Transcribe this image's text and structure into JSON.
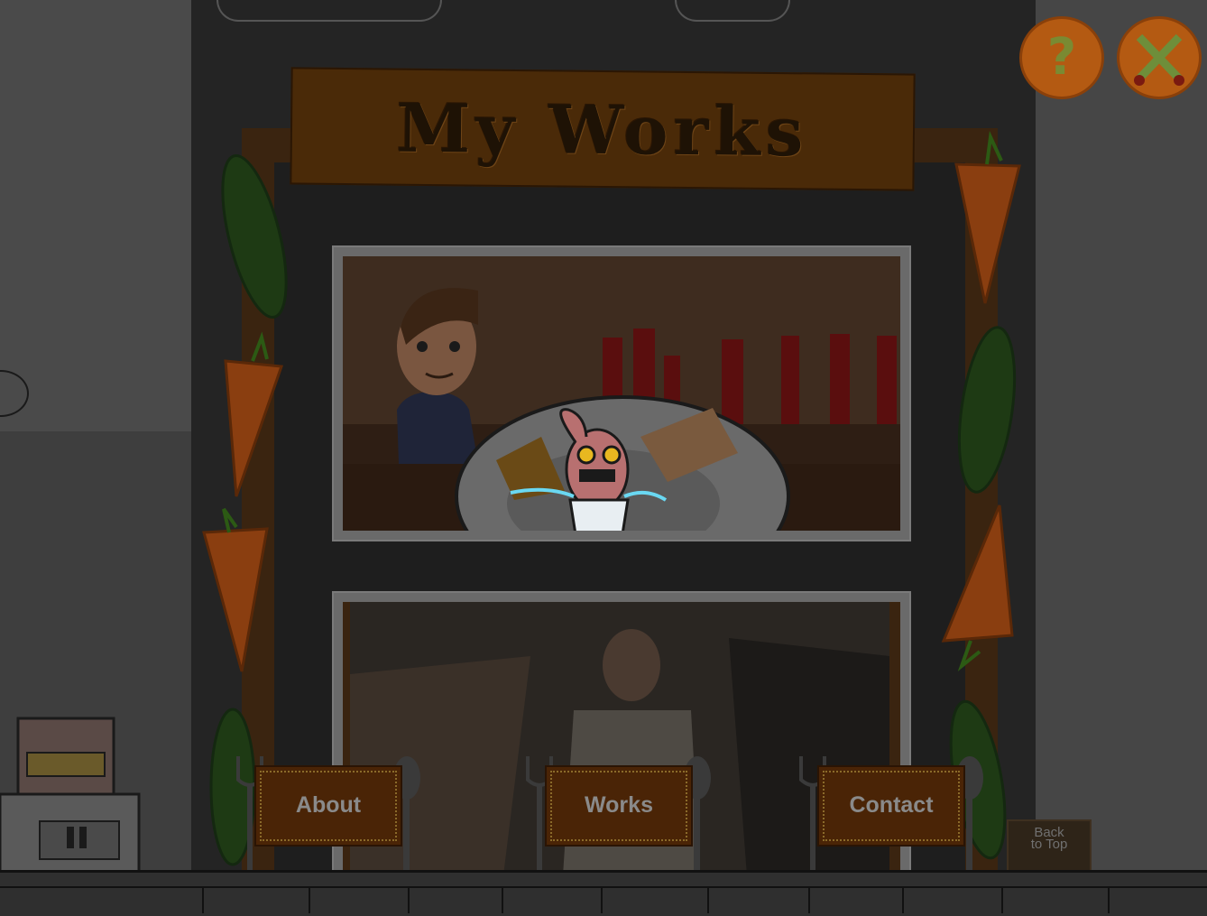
{
  "page": {
    "title": "My Works"
  },
  "top_buttons": {
    "help": {
      "icon": "question-mark-icon",
      "glyph": "?"
    },
    "close": {
      "icon": "crossed-swords-icon"
    }
  },
  "nav": {
    "items": [
      {
        "label": "About"
      },
      {
        "label": "Works"
      },
      {
        "label": "Contact"
      }
    ],
    "back_to_top": {
      "line1": "Back",
      "line2": "to Top"
    }
  },
  "colors": {
    "sign": "#4a2a08",
    "button_orange": "#b45a12",
    "wall": "#242424"
  }
}
